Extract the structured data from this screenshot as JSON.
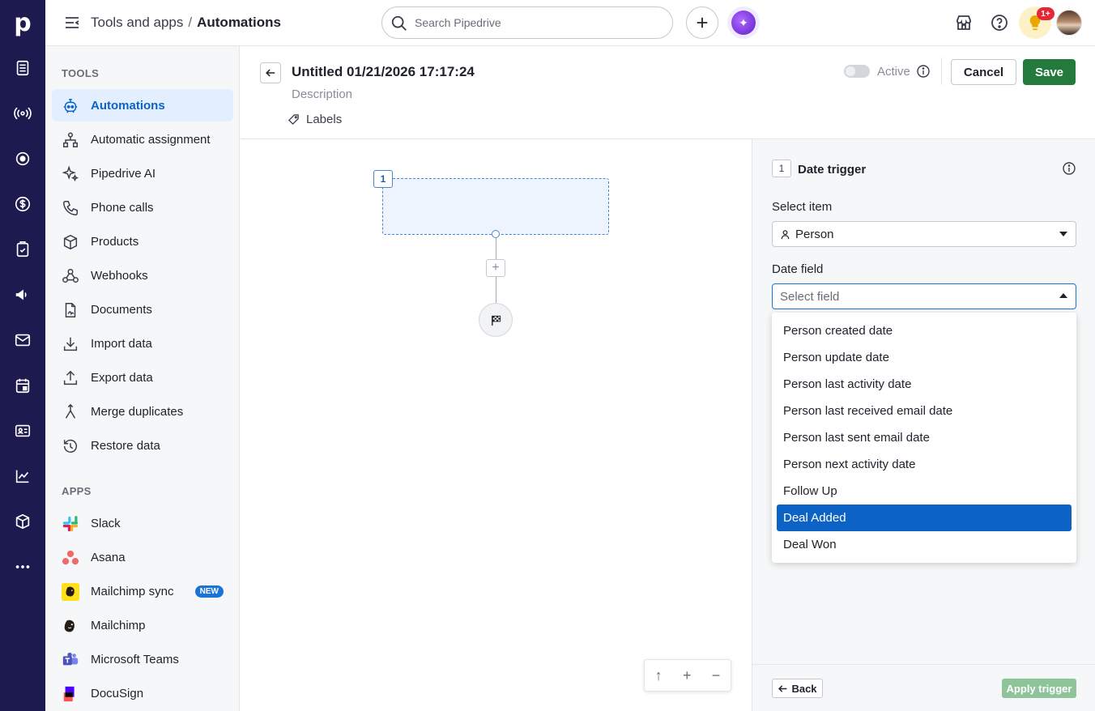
{
  "app": {
    "logo_text": "p"
  },
  "rail": {
    "icons": [
      "leads-inbox-icon",
      "campaigns-broadcast-icon",
      "deals-target-icon",
      "money-icon",
      "activities-icon",
      "megaphone-icon",
      "mail-icon",
      "calendar-icon",
      "contacts-icon",
      "insights-icon",
      "products-icon",
      "more-icon"
    ]
  },
  "topbar": {
    "breadcrumb_parent": "Tools and apps",
    "breadcrumb_sep": "/",
    "breadcrumb_current": "Automations",
    "search_placeholder": "Search Pipedrive",
    "notification_count": "1+"
  },
  "sidebar": {
    "tools_title": "TOOLS",
    "tools": [
      {
        "label": "Automations",
        "icon": "robot-icon",
        "active": true
      },
      {
        "label": "Automatic assignment",
        "icon": "assignment-icon"
      },
      {
        "label": "Pipedrive AI",
        "icon": "sparkle-icon"
      },
      {
        "label": "Phone calls",
        "icon": "phone-icon"
      },
      {
        "label": "Products",
        "icon": "box-icon"
      },
      {
        "label": "Webhooks",
        "icon": "webhook-icon"
      },
      {
        "label": "Documents",
        "icon": "document-icon"
      },
      {
        "label": "Import data",
        "icon": "import-icon"
      },
      {
        "label": "Export data",
        "icon": "export-icon"
      },
      {
        "label": "Merge duplicates",
        "icon": "merge-icon"
      },
      {
        "label": "Restore data",
        "icon": "restore-icon"
      }
    ],
    "apps_title": "APPS",
    "apps": [
      {
        "label": "Slack",
        "icon": "slack-icon"
      },
      {
        "label": "Asana",
        "icon": "asana-icon"
      },
      {
        "label": "Mailchimp sync",
        "icon": "mailchimp-icon",
        "badge": "NEW"
      },
      {
        "label": "Mailchimp",
        "icon": "mailchimp-icon"
      },
      {
        "label": "Microsoft Teams",
        "icon": "teams-icon"
      },
      {
        "label": "DocuSign",
        "icon": "docusign-icon"
      }
    ]
  },
  "automation": {
    "title": "Untitled 01/21/2026 17:17:24",
    "description_placeholder": "Description",
    "labels": "Labels",
    "active_label": "Active",
    "active": false,
    "cancel_label": "Cancel",
    "save_label": "Save"
  },
  "canvas": {
    "step_number": "1",
    "zoom_up": "↑",
    "zoom_in": "+",
    "zoom_out": "−"
  },
  "panel": {
    "step_number": "1",
    "title": "Date trigger",
    "select_item_label": "Select item",
    "select_item_value": "Person",
    "date_field_label": "Date field",
    "date_field_placeholder": "Select field",
    "options": [
      "Person created date",
      "Person update date",
      "Person last activity date",
      "Person last received email date",
      "Person last sent email date",
      "Person next activity date",
      "Follow Up",
      "Deal Added",
      "Deal Won"
    ],
    "highlighted_option": "Deal Added",
    "back_label": "Back",
    "apply_label": "Apply trigger"
  },
  "colors": {
    "rail_bg": "#1c1a4e",
    "accent_blue": "#0d63c5",
    "save_green": "#237a3c",
    "apply_green_disabled": "#8fc49b"
  }
}
